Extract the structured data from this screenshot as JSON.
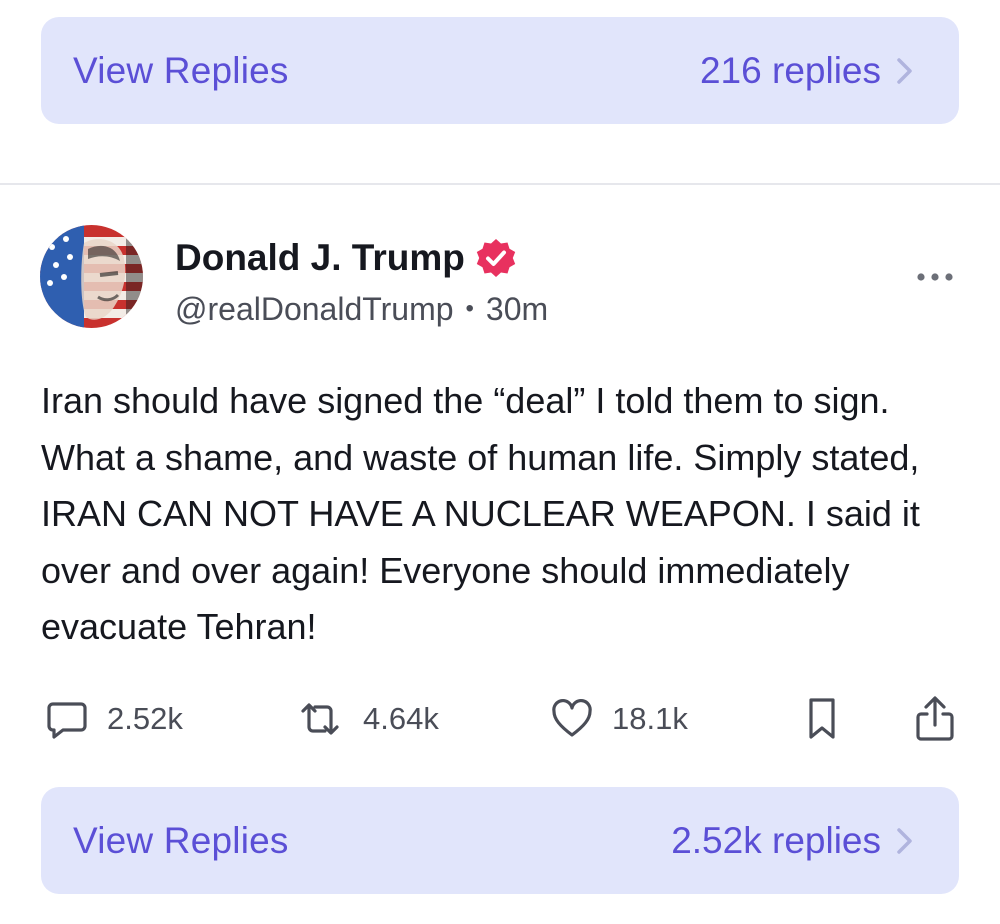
{
  "top_replies": {
    "view_label": "View Replies",
    "count_label": "216 replies"
  },
  "post": {
    "author": {
      "display_name": "Donald J. Trump",
      "handle": "@realDonaldTrump",
      "verified": true
    },
    "separator": "•",
    "time": "30m",
    "body": "Iran should have signed the “deal” I told them to sign. What a shame, and waste of human life. Simply stated, IRAN CAN NOT HAVE A NUCLEAR WEAPON. I said it over and over again! Everyone should immediately evacuate Tehran!",
    "actions": {
      "replies": "2.52k",
      "reposts": "4.64k",
      "likes": "18.1k"
    }
  },
  "bottom_replies": {
    "view_label": "View Replies",
    "count_label": "2.52k replies"
  },
  "icons": {
    "more": "more-icon",
    "reply": "comment-icon",
    "repost": "repost-icon",
    "like": "heart-icon",
    "bookmark": "bookmark-icon",
    "share": "share-icon",
    "chevron": "chevron-right-icon",
    "verified": "verified-badge-icon"
  },
  "colors": {
    "accent": "#5b4fd6",
    "replies_bar_bg": "#e1e5fb",
    "verified_badge": "#e8315f",
    "text_primary": "#16181f",
    "text_secondary": "#4a4d57"
  }
}
